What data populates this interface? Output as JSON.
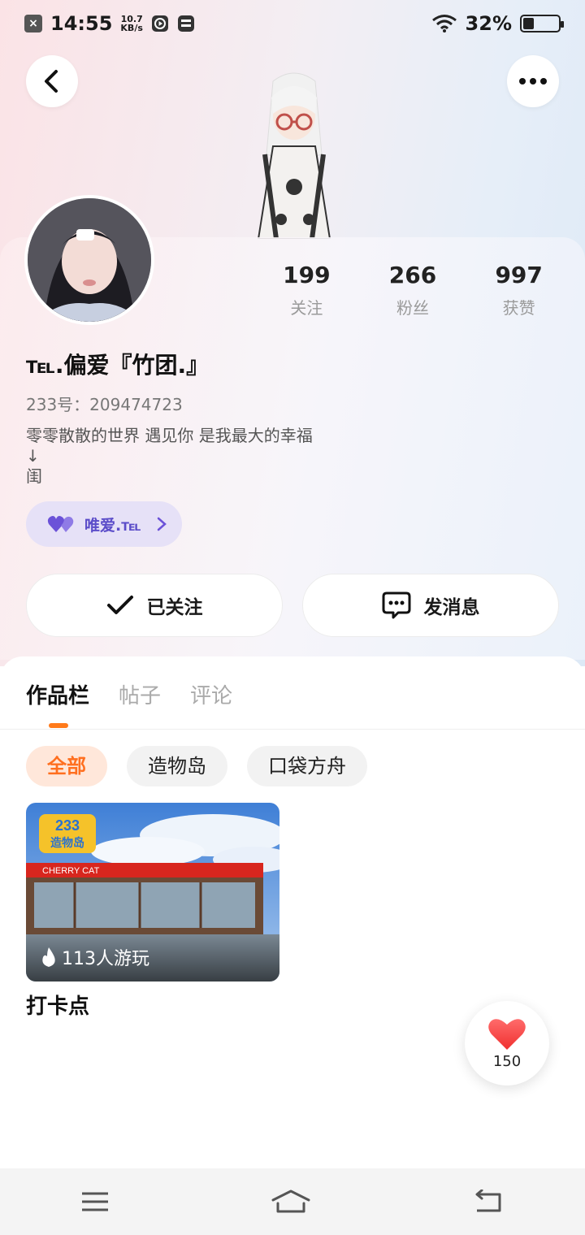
{
  "status_bar": {
    "time": "14:55",
    "net_speed_value": "10.7",
    "net_speed_unit": "KB/s",
    "battery": "32%",
    "battery_level": 0.32
  },
  "header": {
    "back_icon": "chevron-left-icon",
    "more_icon": "more-dots-icon"
  },
  "profile": {
    "stats": [
      {
        "value": "199",
        "label": "关注"
      },
      {
        "value": "266",
        "label": "粉丝"
      },
      {
        "value": "997",
        "label": "获赞"
      }
    ],
    "username": "℡.偏爱『竹团.』",
    "user_id": "233号：209474723",
    "bio": "零零散散的世界  遇见你   是我最大的幸福\n↓\n闺",
    "tag": {
      "label": "唯爱.℡",
      "icon": "double-heart-icon",
      "color": "#5b4dc9"
    }
  },
  "actions": {
    "follow_label": "已关注",
    "message_label": "发消息"
  },
  "tabs": [
    {
      "label": "作品栏",
      "active": true
    },
    {
      "label": "帖子",
      "active": false
    },
    {
      "label": "评论",
      "active": false
    }
  ],
  "chips": [
    {
      "label": "全部",
      "active": true
    },
    {
      "label": "造物岛",
      "active": false
    },
    {
      "label": "口袋方舟",
      "active": false
    }
  ],
  "works": [
    {
      "title": "打卡点",
      "plays": "113人游玩",
      "thumb_logo_top": "233",
      "thumb_logo_bottom": "造物岛",
      "thumb_sign": "CHERRY CAT"
    }
  ],
  "like_float": {
    "count": "150"
  },
  "accent": "#ff7a1a"
}
